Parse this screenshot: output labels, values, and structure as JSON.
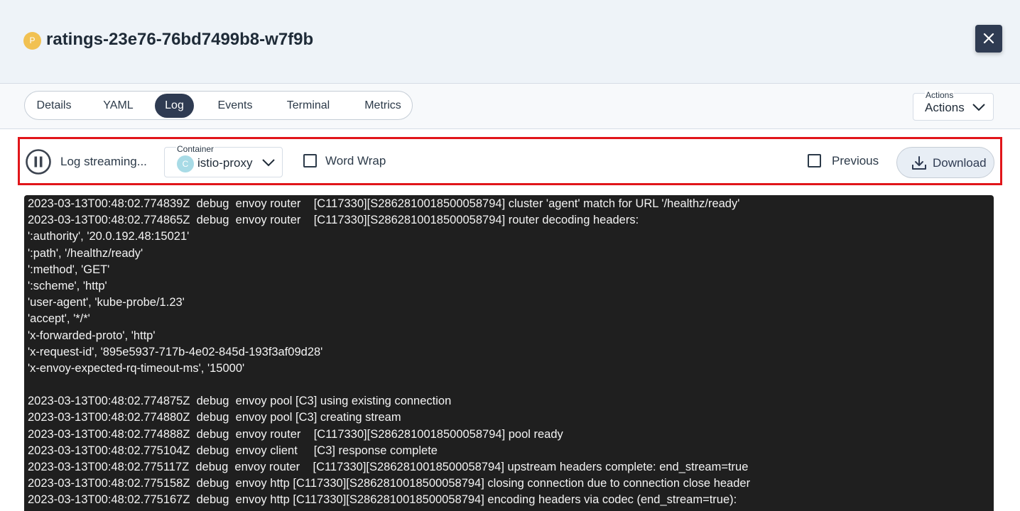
{
  "header": {
    "pod_badge": "P",
    "pod_name": "ratings-23e76-76bd7499b8-w7f9b"
  },
  "tabs": [
    {
      "label": "Details",
      "active": false
    },
    {
      "label": "YAML",
      "active": false
    },
    {
      "label": "Log",
      "active": true
    },
    {
      "label": "Events",
      "active": false
    },
    {
      "label": "Terminal",
      "active": false
    },
    {
      "label": "Metrics",
      "active": false
    }
  ],
  "actions": {
    "label": "Actions",
    "value": "Actions"
  },
  "toolbar": {
    "stream_label": "Log streaming...",
    "container_label": "Container",
    "container_badge": "C",
    "container_value": "istio-proxy",
    "word_wrap_label": "Word Wrap",
    "word_wrap_checked": false,
    "previous_label": "Previous",
    "previous_checked": false,
    "download_label": "Download"
  },
  "log_lines": [
    "2023-03-13T00:48:02.774839Z  debug  envoy router    [C117330][S2862810018500058794] cluster 'agent' match for URL '/healthz/ready'",
    "2023-03-13T00:48:02.774865Z  debug  envoy router    [C117330][S2862810018500058794] router decoding headers:",
    "':authority', '20.0.192.48:15021'",
    "':path', '/healthz/ready'",
    "':method', 'GET'",
    "':scheme', 'http'",
    "'user-agent', 'kube-probe/1.23'",
    "'accept', '*/*'",
    "'x-forwarded-proto', 'http'",
    "'x-request-id', '895e5937-717b-4e02-845d-193f3af09d28'",
    "'x-envoy-expected-rq-timeout-ms', '15000'",
    "",
    "2023-03-13T00:48:02.774875Z  debug  envoy pool [C3] using existing connection",
    "2023-03-13T00:48:02.774880Z  debug  envoy pool [C3] creating stream",
    "2023-03-13T00:48:02.774888Z  debug  envoy router    [C117330][S2862810018500058794] pool ready",
    "2023-03-13T00:48:02.775104Z  debug  envoy client     [C3] response complete",
    "2023-03-13T00:48:02.775117Z  debug  envoy router    [C117330][S2862810018500058794] upstream headers complete: end_stream=true",
    "2023-03-13T00:48:02.775158Z  debug  envoy http [C117330][S2862810018500058794] closing connection due to connection close header",
    "2023-03-13T00:48:02.775167Z  debug  envoy http [C117330][S2862810018500058794] encoding headers via codec (end_stream=true):"
  ]
}
